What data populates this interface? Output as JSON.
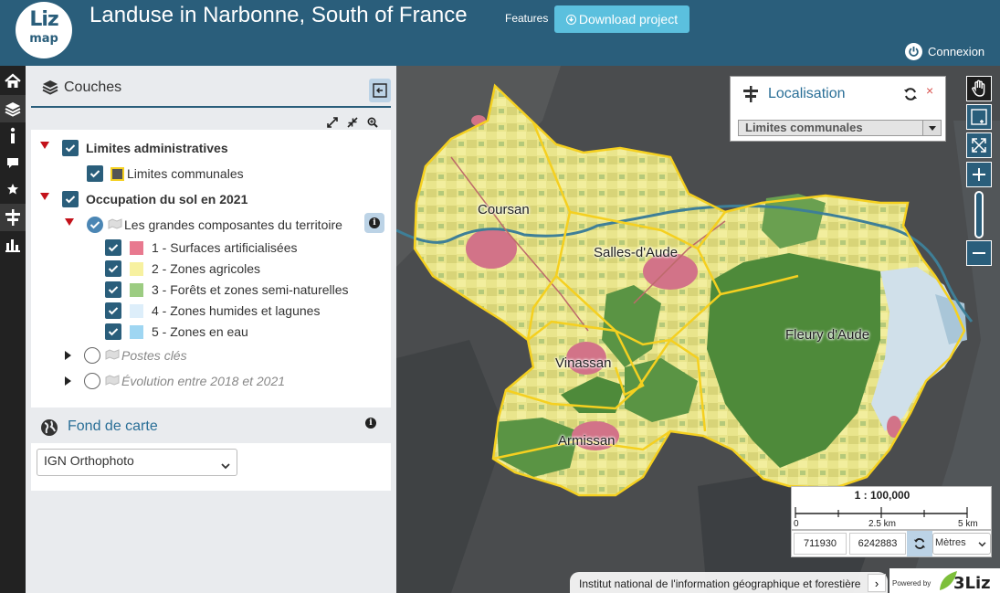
{
  "header": {
    "logo_line1": "Liz",
    "logo_line2": "map",
    "title": "Landuse in Narbonne, South of France",
    "features_label": "Features",
    "download_label": "Download project",
    "login_label": "Connexion",
    "background_color": "#2a5e7b"
  },
  "dock": {
    "items": [
      "home-icon",
      "layers-icon",
      "info-icon",
      "comment-icon",
      "star-icon",
      "signpost-icon",
      "chart-icon"
    ],
    "active": "layers-icon"
  },
  "layers_panel": {
    "title": "Couches",
    "tree": [
      {
        "label": "Limites administratives",
        "type": "group",
        "expanded": true,
        "checked": true
      },
      {
        "label": "Limites communales",
        "type": "layer",
        "checked": true
      },
      {
        "label": "Occupation du sol en 2021",
        "type": "group",
        "expanded": true,
        "checked": true
      },
      {
        "label": "Les grandes composantes du territoire",
        "type": "layer",
        "expanded": true,
        "checked": true
      },
      {
        "label": "Postes clés",
        "type": "layer",
        "expanded": false,
        "checked": false
      },
      {
        "label": "Évolution entre 2018 et 2021",
        "type": "layer",
        "expanded": false,
        "checked": false
      }
    ],
    "legend": [
      {
        "label": "1 - Surfaces artificialisées",
        "color": "#e8798f",
        "checked": true
      },
      {
        "label": "2 - Zones agricoles",
        "color": "#f7f1a0",
        "checked": true
      },
      {
        "label": "3 - Forêts et zones semi-naturelles",
        "color": "#9ccc82",
        "checked": true
      },
      {
        "label": "4 - Zones humides et lagunes",
        "color": "#ddeefa",
        "checked": true
      },
      {
        "label": "5 - Zones en eau",
        "color": "#9fd6f2",
        "checked": true
      }
    ]
  },
  "basemap": {
    "title": "Fond de carte",
    "selected": "IGN Orthophoto"
  },
  "map": {
    "towns": [
      "Coursan",
      "Salles-d'Aude",
      "Fleury d'Aude",
      "Vinassan",
      "Armissan"
    ],
    "boundary_color": "#f5d020"
  },
  "localisation": {
    "title": "Localisation",
    "close_symbol": "×",
    "selected": "Limites communales"
  },
  "scale": {
    "ratio": "1 : 100,000",
    "ticks": [
      "0",
      "2.5 km",
      "5 km"
    ]
  },
  "coordinates": {
    "x": "711930",
    "y": "6242883",
    "units": "Mètres"
  },
  "attribution": {
    "text": "Institut national de l'information géographique et forestière",
    "toggle": "›",
    "powered_by": "Powered by",
    "powered_logo": "3Liz"
  }
}
